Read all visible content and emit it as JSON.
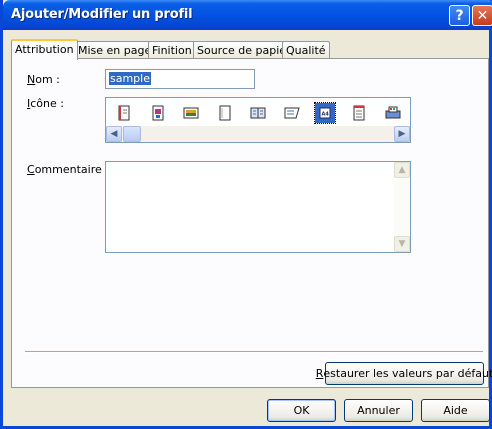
{
  "window": {
    "title": "Ajouter/Modifier un profil",
    "help_glyph": "?",
    "close_glyph": "✕"
  },
  "tabs": [
    {
      "label": "Attribution",
      "active": true
    },
    {
      "label": "Mise en page",
      "active": false
    },
    {
      "label": "Finition",
      "active": false
    },
    {
      "label": "Source de papier",
      "active": false
    },
    {
      "label": "Qualité",
      "active": false
    }
  ],
  "form": {
    "name_label_u": "N",
    "name_label_rest": "om :",
    "name_value": "sample",
    "icon_label_u": "I",
    "icon_label_rest": "cône :",
    "comment_label_u": "C",
    "comment_label_rest": "ommentaire :",
    "comment_value": ""
  },
  "icons": [
    {
      "name": "document-portrait-icon"
    },
    {
      "name": "document-color-icon"
    },
    {
      "name": "image-photo-icon"
    },
    {
      "name": "document-blank-icon"
    },
    {
      "name": "booklet-icon"
    },
    {
      "name": "document-folded-icon"
    },
    {
      "name": "paper-a4-icon",
      "selected": true
    },
    {
      "name": "document-lines-icon"
    },
    {
      "name": "printer-color-icon"
    }
  ],
  "buttons": {
    "restore_u": "R",
    "restore_rest": "estaurer les valeurs par défaut",
    "ok": "OK",
    "cancel": "Annuler",
    "help": "Aide"
  },
  "colors": {
    "titlebar": "#0554e3",
    "selection": "#316ac5",
    "active_tab_accent": "#ffc83c"
  }
}
